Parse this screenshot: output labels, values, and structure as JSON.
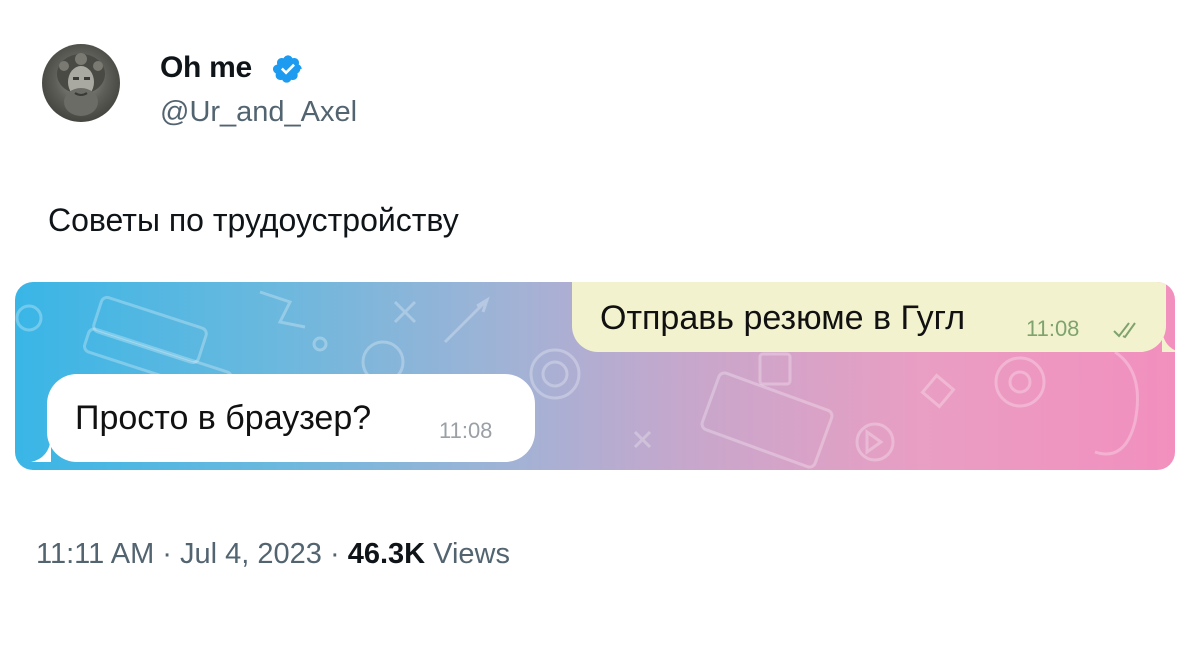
{
  "author": {
    "display_name": "Oh me",
    "handle": "@Ur_and_Axel",
    "verified_icon": "verified-badge-icon",
    "verified_color": "#1d9bf0"
  },
  "tweet": {
    "text": "Советы по трудоустройству"
  },
  "chat": {
    "outgoing": {
      "text": "Отправь резюме в Гугл",
      "time": "11:08"
    },
    "incoming": {
      "text": "Просто в браузер?",
      "time": "11:08"
    }
  },
  "footer": {
    "time": "11:11 AM",
    "separator1": "·",
    "date": "Jul 4, 2023",
    "separator2": "·",
    "views_count": "46.3K",
    "views_label": "Views"
  }
}
